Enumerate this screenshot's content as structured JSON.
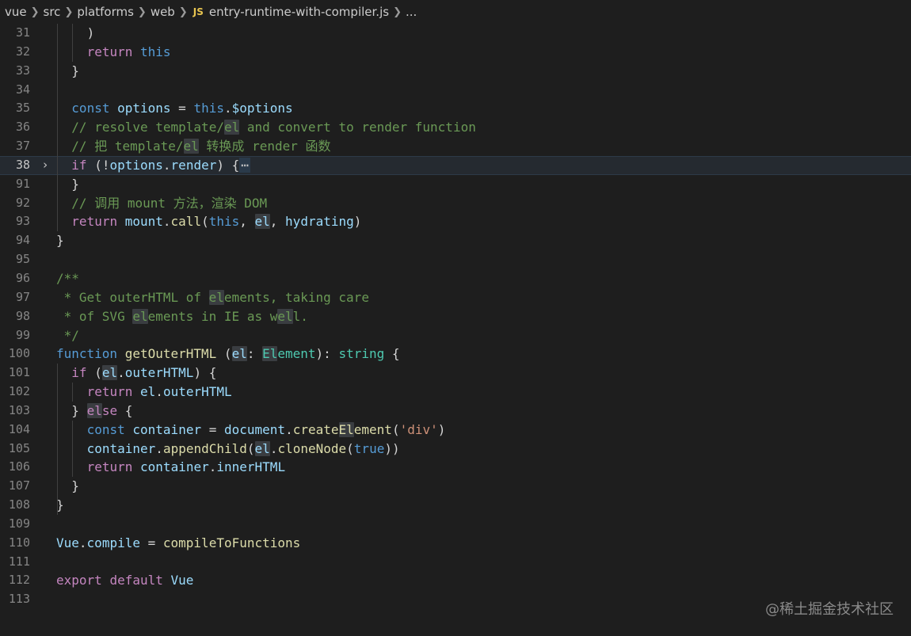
{
  "breadcrumb": {
    "items": [
      "vue",
      "src",
      "platforms",
      "web"
    ],
    "file_badge": "JS",
    "file_name": "entry-runtime-with-compiler.js",
    "more": "..."
  },
  "editor": {
    "fold_marker": "⋯",
    "active_line": "38",
    "lines": [
      {
        "n": "31",
        "indent": 2,
        "tokens": [
          {
            "t": ")",
            "c": "pl"
          }
        ]
      },
      {
        "n": "32",
        "indent": 2,
        "tokens": [
          {
            "t": "return ",
            "c": "ctl"
          },
          {
            "t": "this",
            "c": "kw"
          }
        ]
      },
      {
        "n": "33",
        "indent": 1,
        "tokens": [
          {
            "t": "}",
            "c": "pl"
          }
        ]
      },
      {
        "n": "34",
        "indent": 0,
        "tokens": []
      },
      {
        "n": "35",
        "indent": 1,
        "tokens": [
          {
            "t": "const ",
            "c": "kw"
          },
          {
            "t": "options",
            "c": "var"
          },
          {
            "t": " = ",
            "c": "pl"
          },
          {
            "t": "this",
            "c": "kw"
          },
          {
            "t": ".",
            "c": "pl"
          },
          {
            "t": "$options",
            "c": "var"
          }
        ]
      },
      {
        "n": "36",
        "indent": 1,
        "tokens": [
          {
            "t": "// resolve template/",
            "c": "cm"
          },
          {
            "t": "el",
            "c": "cm hl"
          },
          {
            "t": " and convert to render function",
            "c": "cm"
          }
        ]
      },
      {
        "n": "37",
        "indent": 1,
        "tokens": [
          {
            "t": "// 把 template/",
            "c": "cm"
          },
          {
            "t": "el",
            "c": "cm hl"
          },
          {
            "t": " 转换成 render 函数",
            "c": "cm"
          }
        ]
      },
      {
        "n": "38",
        "indent": 1,
        "fold": true,
        "tokens": [
          {
            "t": "if",
            "c": "ctl"
          },
          {
            "t": " (!",
            "c": "pl"
          },
          {
            "t": "options",
            "c": "var"
          },
          {
            "t": ".",
            "c": "pl"
          },
          {
            "t": "render",
            "c": "var"
          },
          {
            "t": ") {",
            "c": "pl"
          },
          {
            "t": "⋯",
            "c": "ell"
          }
        ]
      },
      {
        "n": "91",
        "indent": 1,
        "tokens": [
          {
            "t": "}",
            "c": "pl"
          }
        ]
      },
      {
        "n": "92",
        "indent": 1,
        "tokens": [
          {
            "t": "// 调用 mount 方法，渲染 DOM",
            "c": "cm"
          }
        ]
      },
      {
        "n": "93",
        "indent": 1,
        "tokens": [
          {
            "t": "return ",
            "c": "ctl"
          },
          {
            "t": "mount",
            "c": "var"
          },
          {
            "t": ".",
            "c": "pl"
          },
          {
            "t": "call",
            "c": "fn"
          },
          {
            "t": "(",
            "c": "pl"
          },
          {
            "t": "this",
            "c": "kw"
          },
          {
            "t": ", ",
            "c": "pl"
          },
          {
            "t": "el",
            "c": "var hl"
          },
          {
            "t": ", ",
            "c": "pl"
          },
          {
            "t": "hydrating",
            "c": "var"
          },
          {
            "t": ")",
            "c": "pl"
          }
        ]
      },
      {
        "n": "94",
        "indent": 0,
        "tokens": [
          {
            "t": "}",
            "c": "pl"
          }
        ]
      },
      {
        "n": "95",
        "indent": 0,
        "tokens": []
      },
      {
        "n": "96",
        "indent": 0,
        "tokens": [
          {
            "t": "/**",
            "c": "cm"
          }
        ]
      },
      {
        "n": "97",
        "indent": 0,
        "tokens": [
          {
            "t": " * Get outerHTML of ",
            "c": "cm"
          },
          {
            "t": "el",
            "c": "cm hl"
          },
          {
            "t": "ements, taking care",
            "c": "cm"
          }
        ]
      },
      {
        "n": "98",
        "indent": 0,
        "tokens": [
          {
            "t": " * of SVG ",
            "c": "cm"
          },
          {
            "t": "el",
            "c": "cm hl"
          },
          {
            "t": "ements in IE as w",
            "c": "cm"
          },
          {
            "t": "el",
            "c": "cm hl"
          },
          {
            "t": "l.",
            "c": "cm"
          }
        ]
      },
      {
        "n": "99",
        "indent": 0,
        "tokens": [
          {
            "t": " */",
            "c": "cm"
          }
        ]
      },
      {
        "n": "100",
        "indent": 0,
        "tokens": [
          {
            "t": "function ",
            "c": "kw"
          },
          {
            "t": "getOuterHTML",
            "c": "fn"
          },
          {
            "t": " (",
            "c": "pl"
          },
          {
            "t": "el",
            "c": "var hl"
          },
          {
            "t": ": ",
            "c": "pl"
          },
          {
            "t": "El",
            "c": "type hl"
          },
          {
            "t": "ement",
            "c": "type"
          },
          {
            "t": "): ",
            "c": "pl"
          },
          {
            "t": "string",
            "c": "type"
          },
          {
            "t": " {",
            "c": "pl"
          }
        ]
      },
      {
        "n": "101",
        "indent": 1,
        "tokens": [
          {
            "t": "if",
            "c": "ctl"
          },
          {
            "t": " (",
            "c": "pl"
          },
          {
            "t": "el",
            "c": "var hl"
          },
          {
            "t": ".",
            "c": "pl"
          },
          {
            "t": "outerHTML",
            "c": "var"
          },
          {
            "t": ") {",
            "c": "pl"
          }
        ]
      },
      {
        "n": "102",
        "indent": 2,
        "tokens": [
          {
            "t": "return ",
            "c": "ctl"
          },
          {
            "t": "el",
            "c": "var"
          },
          {
            "t": ".",
            "c": "pl"
          },
          {
            "t": "outerHTML",
            "c": "var"
          }
        ]
      },
      {
        "n": "103",
        "indent": 1,
        "tokens": [
          {
            "t": "} ",
            "c": "pl"
          },
          {
            "t": "el",
            "c": "ctl hl"
          },
          {
            "t": "se",
            "c": "ctl"
          },
          {
            "t": " {",
            "c": "pl"
          }
        ]
      },
      {
        "n": "104",
        "indent": 2,
        "tokens": [
          {
            "t": "const ",
            "c": "kw"
          },
          {
            "t": "container",
            "c": "var"
          },
          {
            "t": " = ",
            "c": "pl"
          },
          {
            "t": "document",
            "c": "var"
          },
          {
            "t": ".",
            "c": "pl"
          },
          {
            "t": "create",
            "c": "fn"
          },
          {
            "t": "El",
            "c": "fn hl"
          },
          {
            "t": "ement",
            "c": "fn"
          },
          {
            "t": "(",
            "c": "pl"
          },
          {
            "t": "'div'",
            "c": "str"
          },
          {
            "t": ")",
            "c": "pl"
          }
        ]
      },
      {
        "n": "105",
        "indent": 2,
        "tokens": [
          {
            "t": "container",
            "c": "var"
          },
          {
            "t": ".",
            "c": "pl"
          },
          {
            "t": "appendChild",
            "c": "fn"
          },
          {
            "t": "(",
            "c": "pl"
          },
          {
            "t": "el",
            "c": "var hl"
          },
          {
            "t": ".",
            "c": "pl"
          },
          {
            "t": "cloneNode",
            "c": "fn"
          },
          {
            "t": "(",
            "c": "pl"
          },
          {
            "t": "true",
            "c": "kw"
          },
          {
            "t": "))",
            "c": "pl"
          }
        ]
      },
      {
        "n": "106",
        "indent": 2,
        "tokens": [
          {
            "t": "return ",
            "c": "ctl"
          },
          {
            "t": "container",
            "c": "var"
          },
          {
            "t": ".",
            "c": "pl"
          },
          {
            "t": "innerHTML",
            "c": "var"
          }
        ]
      },
      {
        "n": "107",
        "indent": 1,
        "tokens": [
          {
            "t": "}",
            "c": "pl"
          }
        ]
      },
      {
        "n": "108",
        "indent": 0,
        "tokens": [
          {
            "t": "}",
            "c": "pl"
          }
        ]
      },
      {
        "n": "109",
        "indent": 0,
        "tokens": []
      },
      {
        "n": "110",
        "indent": 0,
        "tokens": [
          {
            "t": "Vue",
            "c": "var"
          },
          {
            "t": ".",
            "c": "pl"
          },
          {
            "t": "compile",
            "c": "var"
          },
          {
            "t": " = ",
            "c": "pl"
          },
          {
            "t": "compileToFunctions",
            "c": "fn"
          }
        ]
      },
      {
        "n": "111",
        "indent": 0,
        "tokens": []
      },
      {
        "n": "112",
        "indent": 0,
        "tokens": [
          {
            "t": "export ",
            "c": "ctl"
          },
          {
            "t": "default ",
            "c": "ctl"
          },
          {
            "t": "Vue",
            "c": "var"
          }
        ]
      },
      {
        "n": "113",
        "indent": 0,
        "tokens": []
      }
    ]
  },
  "watermark": "@稀土掘金技术社区"
}
